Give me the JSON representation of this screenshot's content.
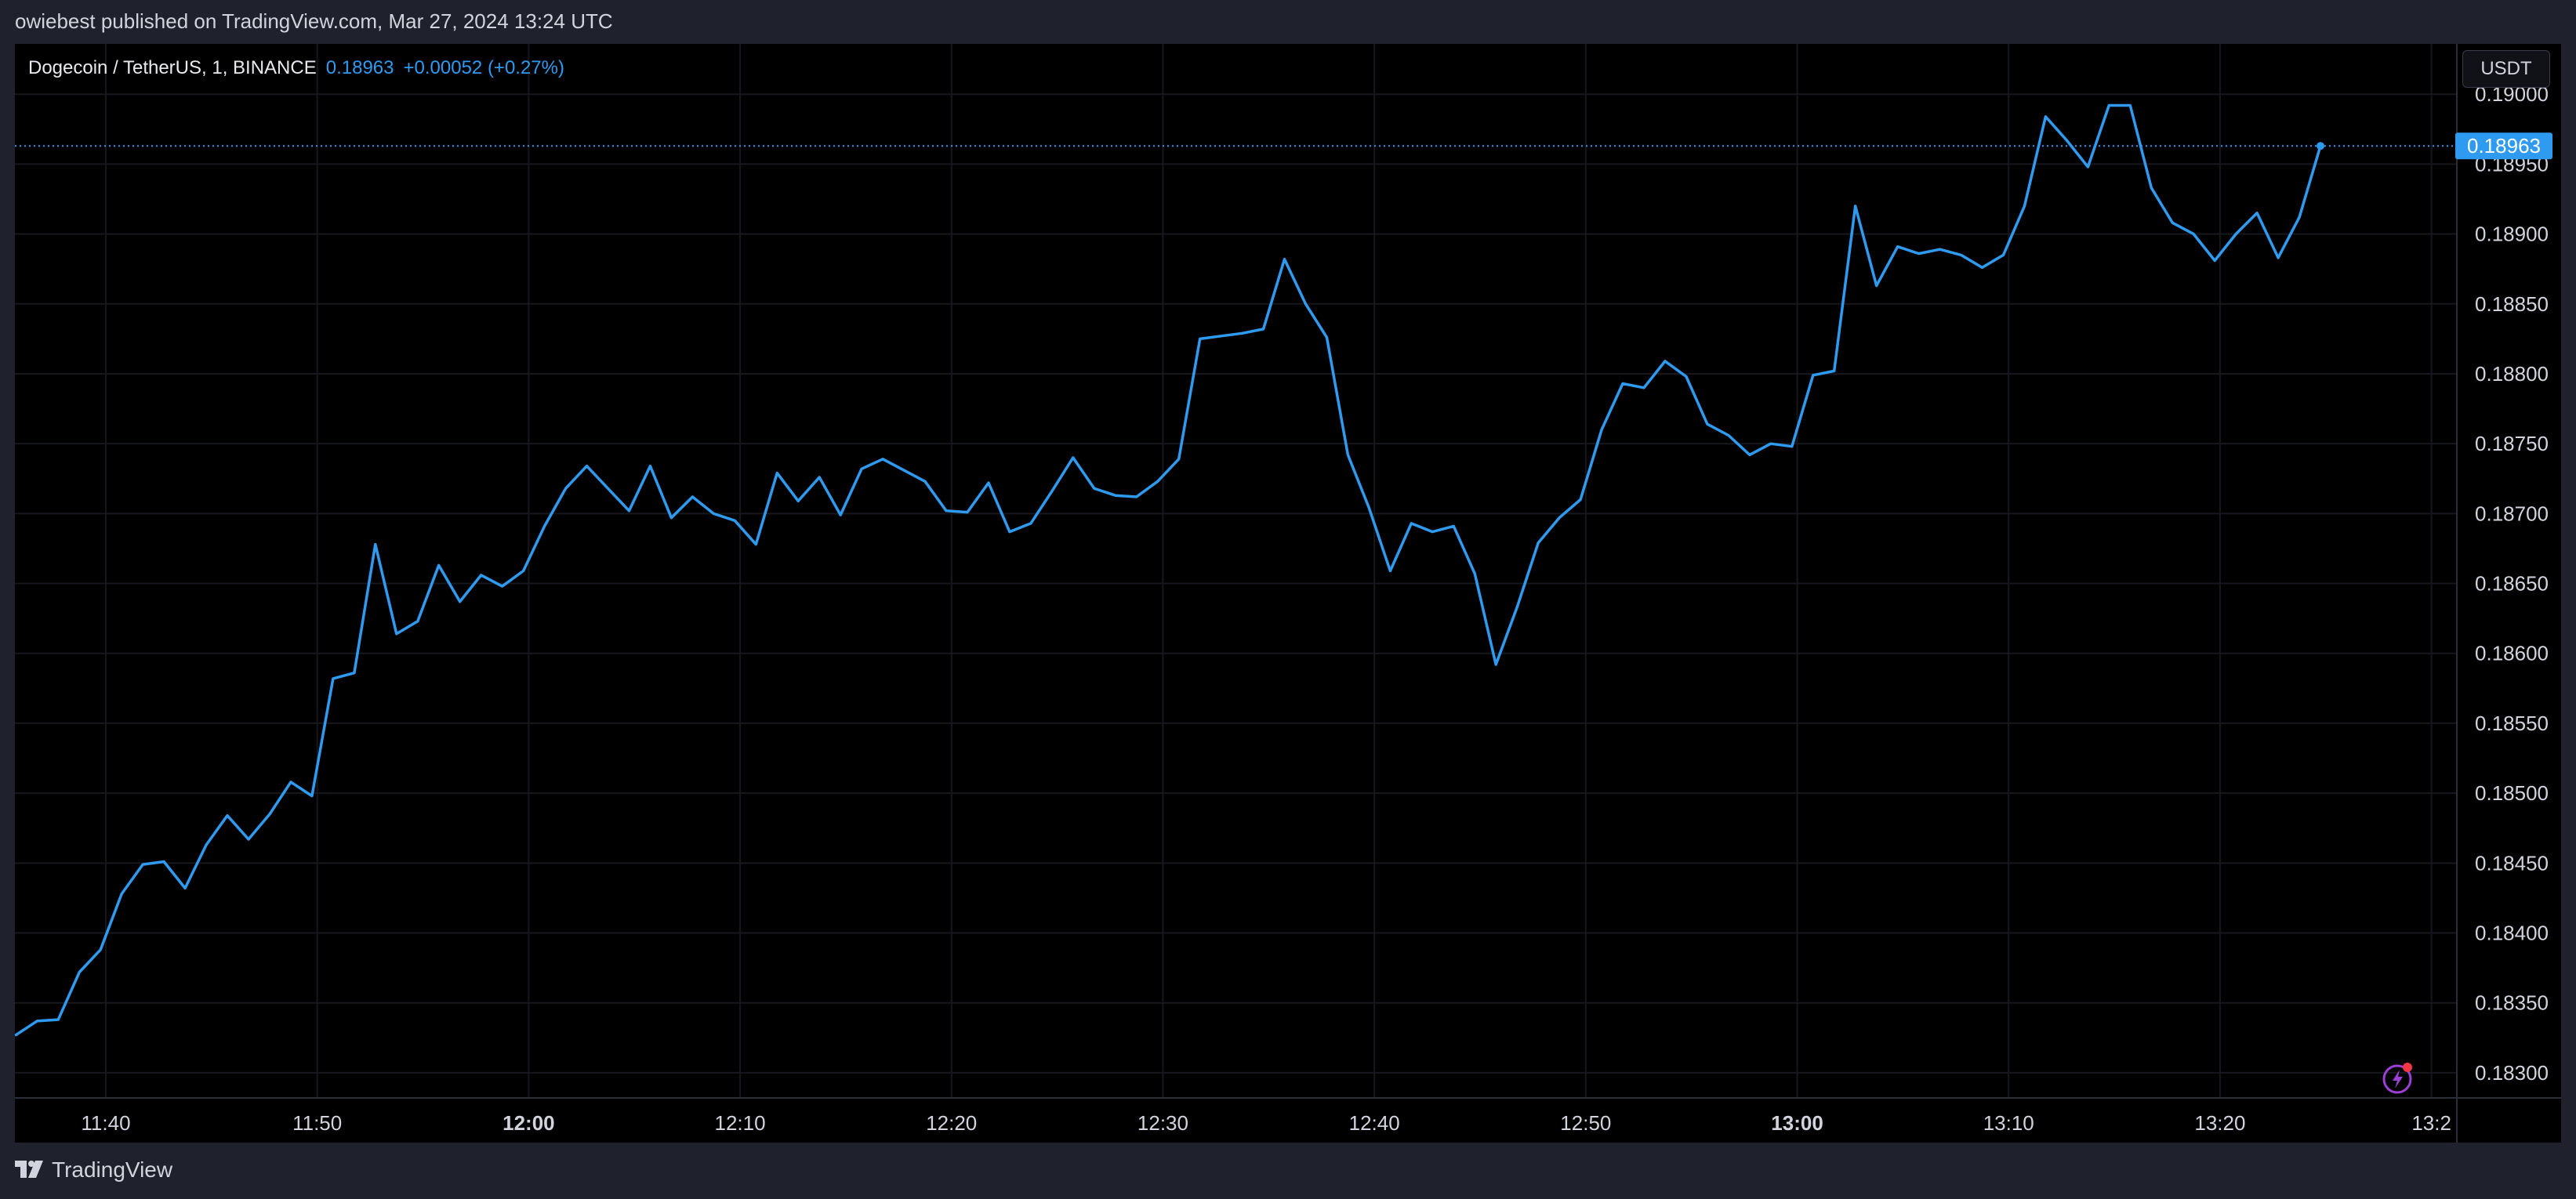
{
  "header": {
    "published": "owiebest published on TradingView.com, Mar 27, 2024 13:24 UTC"
  },
  "legend": {
    "symbol": "Dogecoin / TetherUS, 1, BINANCE",
    "last": "0.18963",
    "change": "+0.00052 (+0.27%)"
  },
  "currency": "USDT",
  "footer": {
    "brand": "TradingView"
  },
  "colors": {
    "line": "#2f9bf0",
    "background": "#000000",
    "grid": "#16181d",
    "axis_text": "#d1d4dc",
    "price_tag": "#2f9bf0"
  },
  "icons": [
    "lightning-icon",
    "tradingview-logo-icon"
  ],
  "chart_data": {
    "type": "line",
    "title": "Dogecoin / TetherUS, 1, BINANCE",
    "x_unit": "time (1-minute bars)",
    "y_ticks": [
      "0.19000",
      "0.18950",
      "0.18900",
      "0.18850",
      "0.18800",
      "0.18750",
      "0.18700",
      "0.18650",
      "0.18600",
      "0.18550",
      "0.18500",
      "0.18450",
      "0.18400",
      "0.18350",
      "0.18300"
    ],
    "x_ticks": [
      {
        "label": "11:40",
        "minute": 700,
        "bold": false
      },
      {
        "label": "11:50",
        "minute": 710,
        "bold": false
      },
      {
        "label": "12:00",
        "minute": 720,
        "bold": true
      },
      {
        "label": "12:10",
        "minute": 730,
        "bold": false
      },
      {
        "label": "12:20",
        "minute": 740,
        "bold": false
      },
      {
        "label": "12:30",
        "minute": 750,
        "bold": false
      },
      {
        "label": "12:40",
        "minute": 760,
        "bold": false
      },
      {
        "label": "12:50",
        "minute": 770,
        "bold": false
      },
      {
        "label": "13:00",
        "minute": 780,
        "bold": true
      },
      {
        "label": "13:10",
        "minute": 790,
        "bold": false
      },
      {
        "label": "13:20",
        "minute": 800,
        "bold": false
      },
      {
        "label": "13:2",
        "minute": 810,
        "bold": false
      }
    ],
    "ylim": [
      0.18282,
      0.19036
    ],
    "xlim_minutes": [
      695.7,
      811.2
    ],
    "last_price": 0.18963,
    "last_price_label": "0.18963",
    "grid": true,
    "series": [
      {
        "minute_start": 695.75,
        "values": [
          0.18327,
          0.18337,
          0.18338,
          0.18372,
          0.18388,
          0.18428,
          0.18449,
          0.18451,
          0.18432,
          0.18463,
          0.18484,
          0.18467,
          0.18485,
          0.18508,
          0.18498,
          0.18582,
          0.18586,
          0.18678,
          0.18614,
          0.18623,
          0.18663,
          0.18637,
          0.18656,
          0.18648,
          0.18659,
          0.18691,
          0.18718,
          0.18734,
          0.18718,
          0.18702,
          0.18734,
          0.18697,
          0.18712,
          0.187,
          0.18695,
          0.18678,
          0.18729,
          0.18709,
          0.18726,
          0.18699,
          0.18732,
          0.18739,
          0.18731,
          0.18723,
          0.18702,
          0.18701,
          0.18722,
          0.18687,
          0.18693,
          0.18716,
          0.1874,
          0.18718,
          0.18713,
          0.18712,
          0.18723,
          0.18739,
          0.18825,
          0.18827,
          0.18829,
          0.18832,
          0.18882,
          0.1885,
          0.18826,
          0.18742,
          0.18704,
          0.18659,
          0.18693,
          0.18687,
          0.18691,
          0.18657,
          0.18592,
          0.18633,
          0.18679,
          0.18697,
          0.1871,
          0.1876,
          0.18793,
          0.1879,
          0.18809,
          0.18798,
          0.18764,
          0.18756,
          0.18742,
          0.1875,
          0.18748,
          0.18799,
          0.18802,
          0.1892,
          0.18863,
          0.18891,
          0.18886,
          0.18889,
          0.18885,
          0.18876,
          0.18885,
          0.1892,
          0.18984,
          0.18967,
          0.18948,
          0.18992,
          0.18992,
          0.18933,
          0.18908,
          0.189,
          0.18881,
          0.189,
          0.18915,
          0.18883,
          0.18912,
          0.18963
        ]
      }
    ]
  }
}
